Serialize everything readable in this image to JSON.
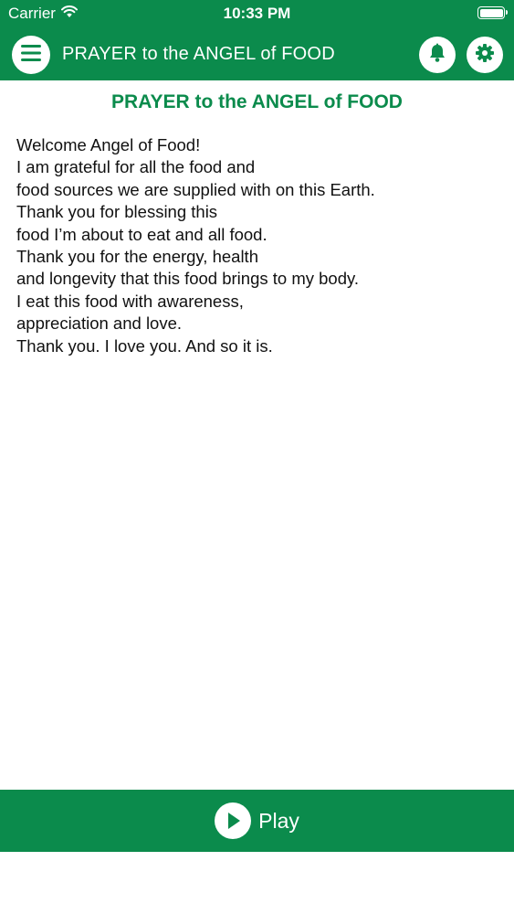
{
  "status_bar": {
    "carrier": "Carrier",
    "time": "10:33 PM",
    "battery_level": 1.0
  },
  "nav": {
    "title": "PRAYER to the ANGEL of FOOD"
  },
  "content": {
    "title": "PRAYER to the ANGEL of FOOD",
    "lines": [
      "Welcome Angel of Food!",
      "I am grateful for all the food and",
      "food sources we are supplied with on this Earth.",
      "Thank you for blessing this",
      "food I’m about to eat and all food.",
      "Thank you for the energy, health",
      "and longevity that this food brings to my body.",
      "I eat this food with awareness,",
      "appreciation and love.",
      "Thank you. I love you. And so it is."
    ]
  },
  "player": {
    "play_label": "Play"
  },
  "colors": {
    "brand_green": "#0b8b4c",
    "text": "#111111",
    "background": "#ffffff"
  },
  "icons": {
    "menu": "hamburger-menu-icon",
    "bell": "bell-icon",
    "gear": "gear-icon",
    "play": "play-icon",
    "wifi": "wifi-icon",
    "battery": "battery-icon"
  }
}
